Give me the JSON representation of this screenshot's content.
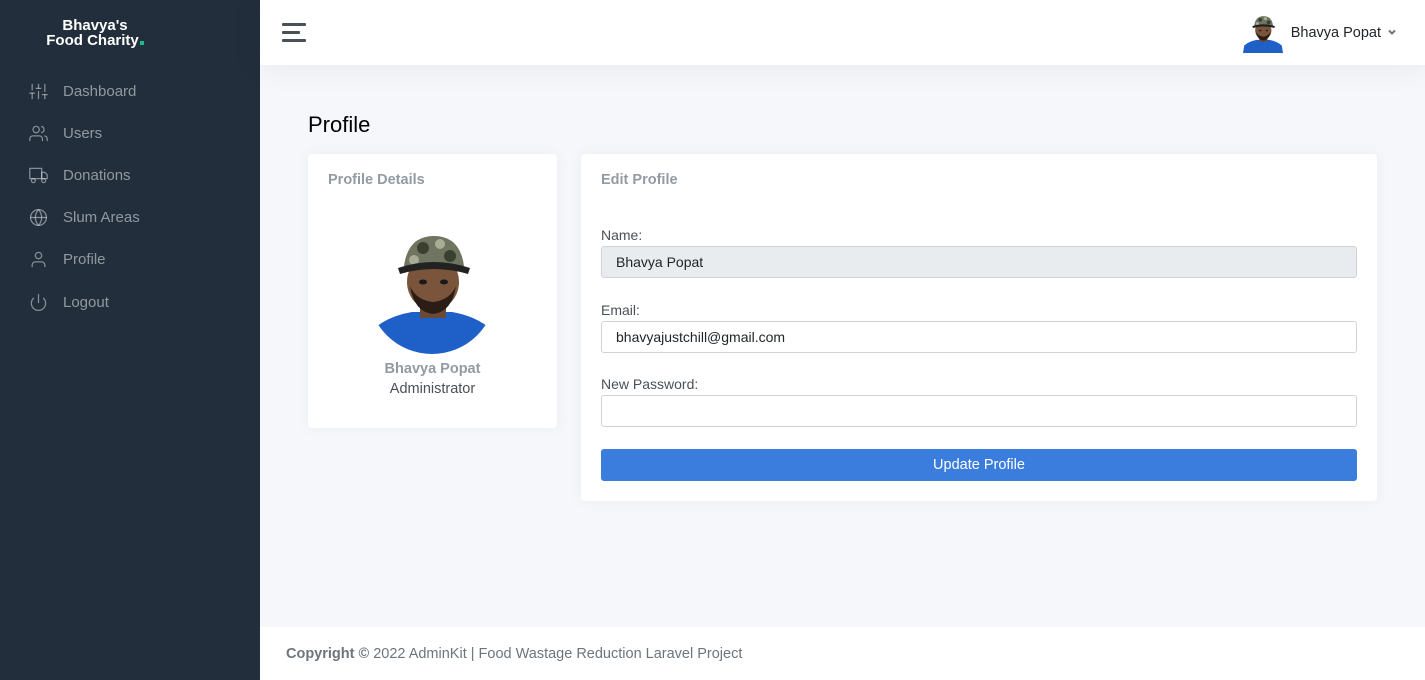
{
  "brand": {
    "line1": "Bhavya's",
    "line2": "Food Charity",
    "dot_color": "#1cbb8c"
  },
  "sidebar": {
    "items": [
      {
        "label": "Dashboard",
        "icon": "sliders-icon"
      },
      {
        "label": "Users",
        "icon": "users-icon"
      },
      {
        "label": "Donations",
        "icon": "truck-icon"
      },
      {
        "label": "Slum Areas",
        "icon": "globe-icon"
      },
      {
        "label": "Profile",
        "icon": "user-icon"
      },
      {
        "label": "Logout",
        "icon": "power-icon"
      }
    ]
  },
  "topbar": {
    "user_name": "Bhavya Popat"
  },
  "page": {
    "title": "Profile"
  },
  "profile_details": {
    "title": "Profile Details",
    "name": "Bhavya Popat",
    "role": "Administrator"
  },
  "edit_profile": {
    "title": "Edit Profile",
    "name_label": "Name:",
    "name_value": "Bhavya Popat",
    "email_label": "Email:",
    "email_value": "bhavyajustchill@gmail.com",
    "password_label": "New Password:",
    "password_value": "",
    "submit_label": "Update Profile"
  },
  "footer": {
    "copyright": "Copyright ©",
    "text": " 2022 AdminKit | Food Wastage Reduction Laravel Project"
  },
  "colors": {
    "sidebar_bg": "#222e3c",
    "primary": "#3b7ddd",
    "page_bg": "#f5f7fb"
  }
}
